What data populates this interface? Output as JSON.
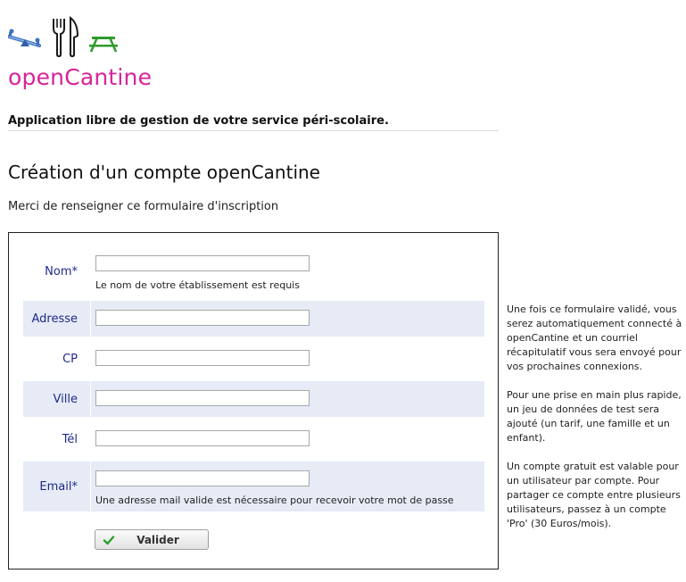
{
  "header": {
    "brand": "openCantine",
    "tagline": "Application libre de gestion de votre service péri-scolaire.",
    "icons": [
      "seesaw-icon",
      "cutlery-icon",
      "picnic-table-icon"
    ]
  },
  "main": {
    "title": "Création d'un compte openCantine",
    "intro": "Merci de renseigner ce formulaire d'inscription"
  },
  "form": {
    "fields": {
      "nom": {
        "label": "Nom*",
        "value": "",
        "hint": "Le nom de votre établissement est requis"
      },
      "adresse": {
        "label": "Adresse",
        "value": ""
      },
      "cp": {
        "label": "CP",
        "value": ""
      },
      "ville": {
        "label": "Ville",
        "value": ""
      },
      "tel": {
        "label": "Tél",
        "value": ""
      },
      "email": {
        "label": "Email*",
        "value": "",
        "hint": "Une adresse mail valide est nécessaire pour recevoir votre mot de passe"
      }
    },
    "submit_label": "Valider"
  },
  "sidebar": {
    "paragraphs": [
      "Une fois ce formulaire validé, vous serez automatiquement connecté à openCantine et un courriel récapitulatif vous sera envoyé pour vos prochaines connexions.",
      "Pour une prise en main plus rapide, un jeu de données de test sera ajouté (un tarif, une famille et un enfant).",
      "Un compte gratuit est valable pour un utilisateur par compte. Pour partager ce compte entre plusieurs utilisateurs, passez à un compte 'Pro' (30 Euros/mois)."
    ]
  },
  "colors": {
    "brand": "#d6249a",
    "label": "#1f2a8a",
    "row_shade": "#e6ebf6",
    "check": "#2aa12a"
  }
}
